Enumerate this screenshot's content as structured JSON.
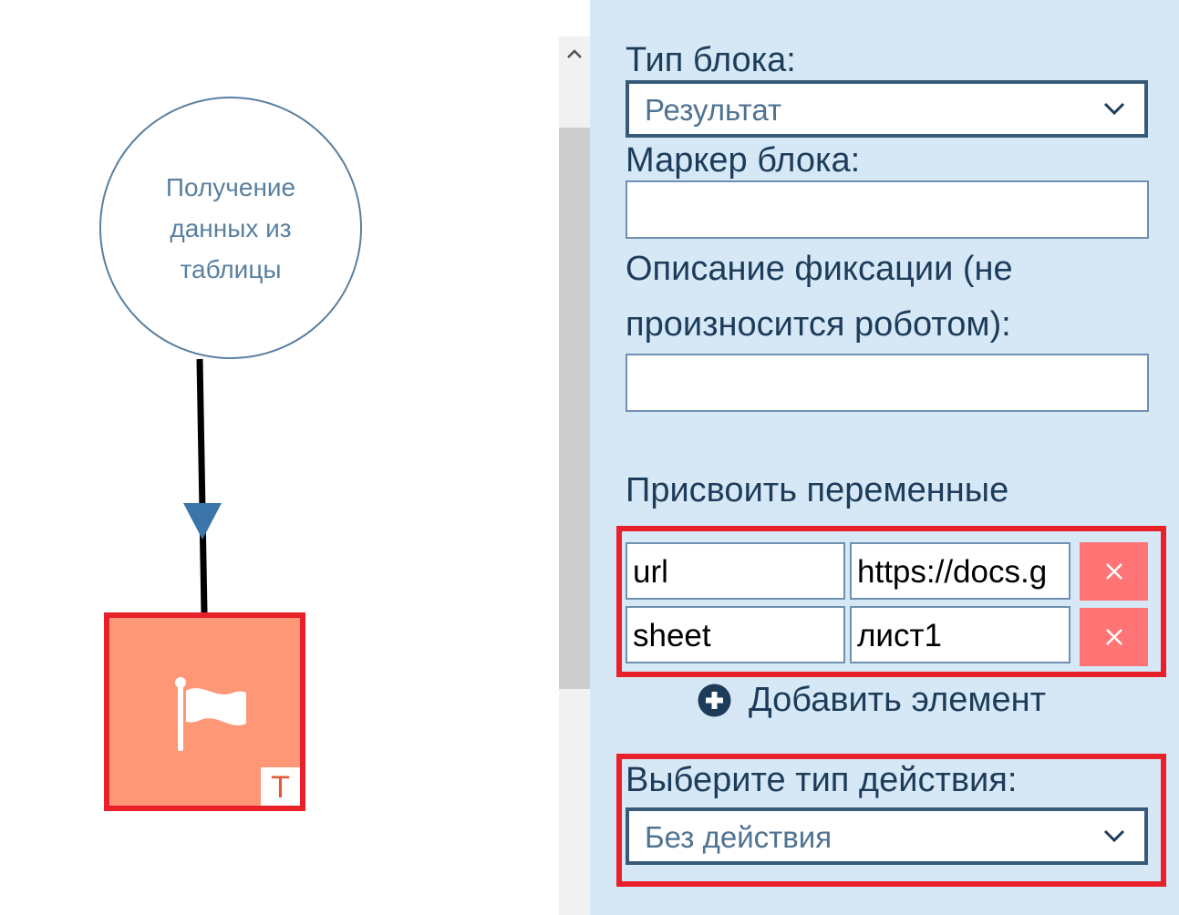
{
  "canvas": {
    "start_node": {
      "label_lines": [
        "Получение",
        "данных из",
        "таблицы"
      ]
    },
    "result_node": {
      "icon": "flag-icon",
      "badge": "T"
    }
  },
  "scrollbar": {
    "up_icon": "chevron-up-icon"
  },
  "panel": {
    "block_type": {
      "label": "Тип блока:",
      "value": "Результат"
    },
    "block_marker": {
      "label": "Маркер блока:",
      "value": ""
    },
    "fixation_description": {
      "label_line1": "Описание фиксации (не",
      "label_line2": "произносится роботом):",
      "value": ""
    },
    "assign_variables": {
      "title": "Присвоить переменные",
      "rows": [
        {
          "name": "url",
          "value": "https://docs.g"
        },
        {
          "name": "sheet",
          "value": "лист1"
        }
      ],
      "remove_symbol": "×"
    },
    "add_element": {
      "label": "Добавить элемент",
      "icon": "plus-circle-icon"
    },
    "action_type": {
      "label": "Выберите тип действия:",
      "value": "Без действия"
    }
  },
  "colors": {
    "panel_bg": "#d6e8f5",
    "highlight": "#e8202a",
    "result_node": "#fe9775",
    "remove_button": "#ff7474",
    "text_dark": "#1d3c5a"
  }
}
